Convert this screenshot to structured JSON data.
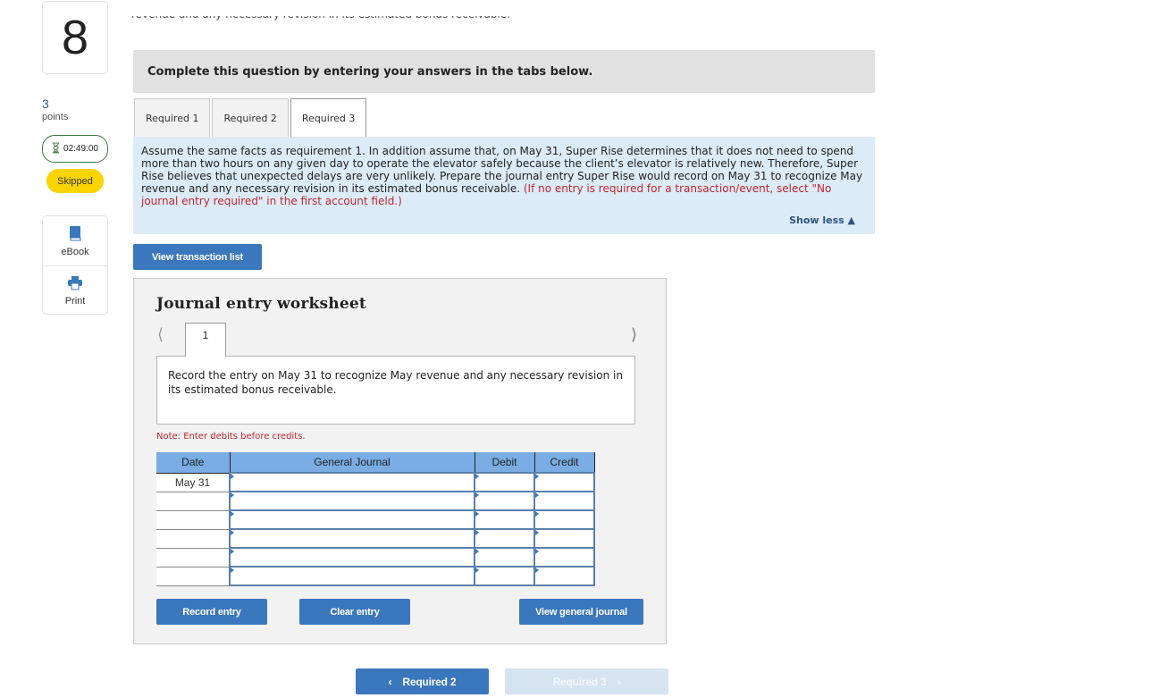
{
  "sidebar": {
    "question_number": "8",
    "points_value": "3",
    "points_label": "points",
    "timer": {
      "icon": "hourglass-icon",
      "value": "02:49:00",
      "color": "#3b7a3b"
    },
    "status_badge": {
      "label": "Skipped",
      "color": "#f9d400"
    },
    "tools": [
      {
        "label": "eBook",
        "icon": "book-icon"
      },
      {
        "label": "Print",
        "icon": "printer-icon"
      }
    ]
  },
  "question": {
    "cut_off_text": "revenue and any necessary revision in its estimated bonus receivable.",
    "instruction_banner": "Complete this question by entering your answers in the tabs below.",
    "tabs": [
      {
        "label": "Required 1",
        "active": false
      },
      {
        "label": "Required 2",
        "active": false
      },
      {
        "label": "Required 3",
        "active": true
      }
    ],
    "prompt": {
      "text": "Assume the same facts as requirement 1. In addition assume that, on May 31, Super Rise determines that it does not need to spend more than two hours on any given day to operate the elevator safely because the client’s elevator is relatively new. Therefore, Super Rise believes that unexpected delays are very unlikely. Prepare the journal entry Super Rise would record on May 31 to recognize May revenue and any necessary revision in its estimated bonus receivable. ",
      "instruction_red": "(If no entry is required for a transaction/event, select \"No journal entry required\" in the first account field.)",
      "show_less_label": "Show less ▲"
    },
    "view_transaction_list_label": "View transaction list"
  },
  "worksheet": {
    "title": "Journal entry worksheet",
    "prev_icon": "chevron-left-icon",
    "next_icon": "chevron-right-icon",
    "current_page": "1",
    "description": "Record the entry on May 31 to recognize May revenue and any necessary revision in its estimated bonus receivable.",
    "note": "Note: Enter debits before credits.",
    "columns": [
      "Date",
      "General Journal",
      "Debit",
      "Credit"
    ],
    "rows": [
      {
        "date": "May 31",
        "account": "",
        "debit": "",
        "credit": ""
      },
      {
        "date": "",
        "account": "",
        "debit": "",
        "credit": ""
      },
      {
        "date": "",
        "account": "",
        "debit": "",
        "credit": ""
      },
      {
        "date": "",
        "account": "",
        "debit": "",
        "credit": ""
      },
      {
        "date": "",
        "account": "",
        "debit": "",
        "credit": ""
      },
      {
        "date": "",
        "account": "",
        "debit": "",
        "credit": ""
      }
    ],
    "buttons": {
      "record": "Record entry",
      "clear": "Clear entry",
      "view_journal": "View general journal"
    }
  },
  "navigation": {
    "prev_label": "Required 2",
    "next_label": "Required 3",
    "next_disabled": true
  },
  "colors": {
    "accent_blue": "#3b77bc",
    "prompt_background": "#dcebf8",
    "instruction_red": "#c0272d",
    "table_header": "#79ade3"
  }
}
